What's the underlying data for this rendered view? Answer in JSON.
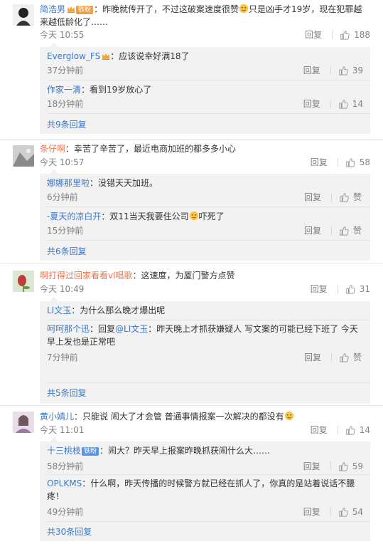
{
  "comments": [
    {
      "author": "简浩男",
      "badge": "铁粉",
      "text_before": "：昨晚就传开了，不过这破案速度很赞",
      "text_after": "只是凶手才19岁，现在犯罪越来越低龄化了……",
      "time": "今天 10:55",
      "reply_label": "回复",
      "likes": "188",
      "replies": [
        {
          "author": "Everglow_FS",
          "text": "：应该说幸好满18了",
          "time": "37分钟前",
          "reply_label": "回复",
          "likes": "39"
        },
        {
          "author": "作家一清",
          "text": "：看到19岁放心了",
          "time": "18分钟前",
          "reply_label": "回复",
          "likes": "14"
        }
      ],
      "more": "共9条回复"
    },
    {
      "author": "条仔啊",
      "text": "：幸苦了辛苦了，最近电商加班的都多多小心",
      "time": "今天 10:57",
      "reply_label": "回复",
      "likes": "58",
      "replies": [
        {
          "author": "娜娜那里啦",
          "text": "：没错天天加班。",
          "time": "6分钟前",
          "reply_label": "回复",
          "likes": "赞"
        },
        {
          "author": "-夏天的凉白开",
          "text_before": "：双11当天我要住公司",
          "text_after": "吓死了",
          "time": "15分钟前",
          "reply_label": "回复",
          "likes": "赞"
        }
      ],
      "more": "共6条回复"
    },
    {
      "author": "啊打得过回家看看vl唱歌",
      "text": "：这速度，为厦门警方点赞",
      "time": "今天 10:49",
      "reply_label": "回复",
      "likes": "31",
      "replies": [
        {
          "author": "LI文玉",
          "text": "：为什么那么晚才爆出呢",
          "time": "",
          "reply_label": "",
          "likes": ""
        },
        {
          "author": "呵呵那个迅",
          "mid_label": "：回复",
          "mention": "@LI文玉",
          "text": "：昨天晚上才抓获嫌疑人 写文案的可能已经下班了 今天早上发也是正常吧",
          "time": "7分钟前",
          "reply_label": "回复",
          "likes": "赞"
        }
      ],
      "more": "共5条回复"
    },
    {
      "author": "黄小婧儿",
      "text": "：只能说 闹大了才会管 普通事情报案一次解决的都没有",
      "time": "今天 11:01",
      "reply_label": "回复",
      "likes": "14",
      "replies": [
        {
          "author": "十三桃枝",
          "badge": "铁粉",
          "text": "：闹大？昨天早上报案昨晚抓获闹什么大……",
          "time": "58分钟前",
          "reply_label": "回复",
          "likes": "59"
        },
        {
          "author": "OPLKMS",
          "text": "：什么啊，昨天传播的时候警方就已经在抓人了，你真的是站着说话不腰疼！",
          "time": "49分钟前",
          "reply_label": "回复",
          "likes": "54"
        }
      ],
      "more": "共30条回复"
    }
  ],
  "colors": {
    "username": "#eb7350",
    "link": "#3c78c8",
    "meta": "#808080",
    "reply_bg": "#f2f2f2"
  },
  "icons": {
    "like": "thumb-up-icon",
    "vip": "crown-icon",
    "emoji": "emoji-icon"
  }
}
